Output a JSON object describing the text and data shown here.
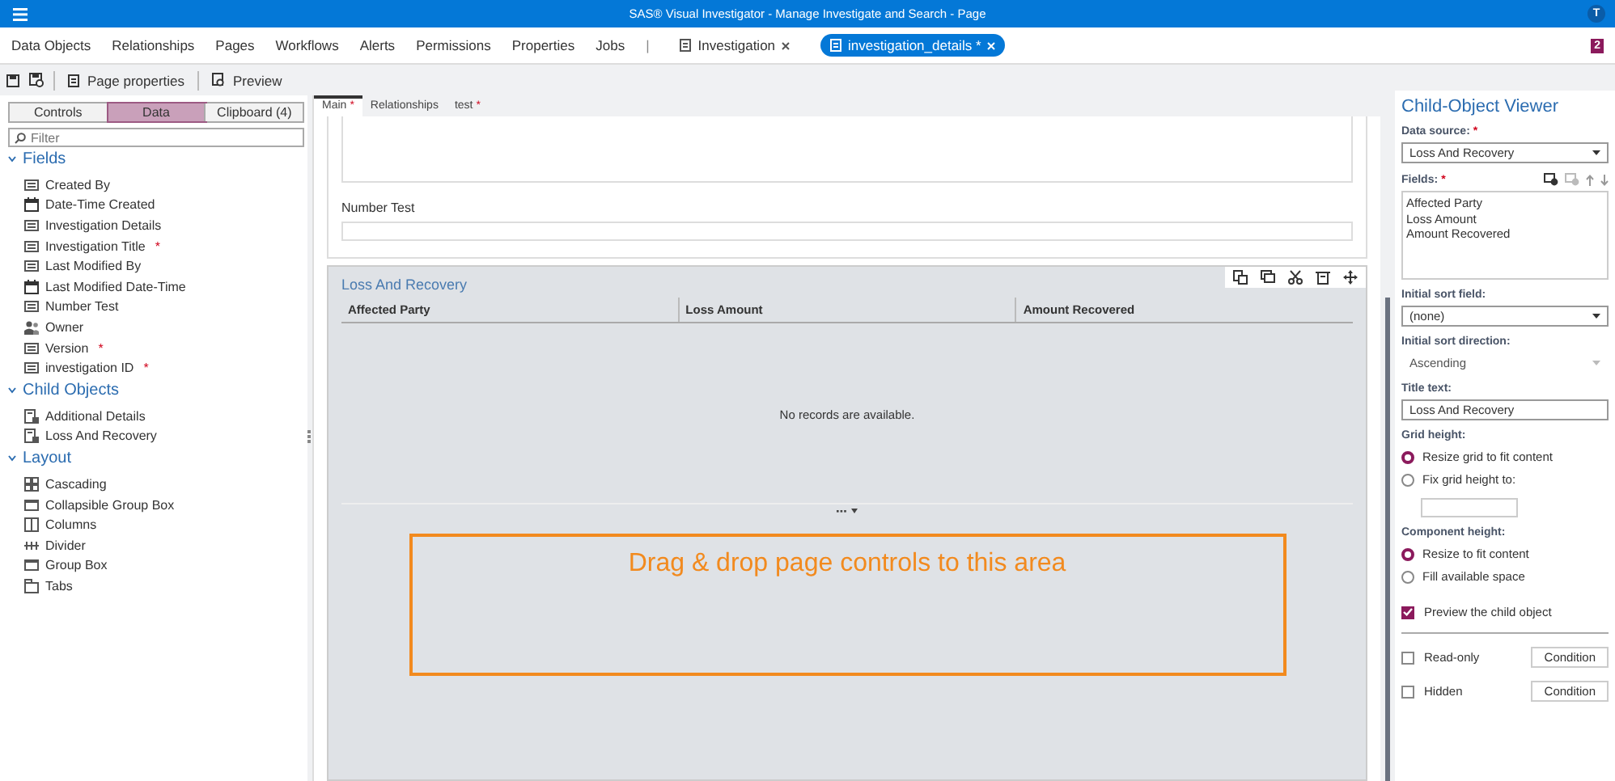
{
  "app_bar": {
    "title": "SAS® Visual Investigator - Manage Investigate and Search - Page",
    "avatar": "T"
  },
  "nav": {
    "items": [
      "Data Objects",
      "Relationships",
      "Pages",
      "Workflows",
      "Alerts",
      "Permissions",
      "Properties",
      "Jobs"
    ],
    "separator": "|",
    "open_tabs": [
      {
        "label": "Investigation",
        "selected": false
      },
      {
        "label": "investigation_details *",
        "selected": true
      }
    ],
    "badge": "2"
  },
  "toolbar": {
    "buttons": [
      "Page properties",
      "Preview"
    ]
  },
  "left_panel": {
    "tabs": [
      {
        "label": "Controls",
        "selected": false
      },
      {
        "label": "Data",
        "selected": true
      },
      {
        "label": "Clipboard (4)",
        "selected": false
      }
    ],
    "filter": {
      "placeholder": "Filter"
    },
    "sections": [
      {
        "title": "Fields",
        "expanded": true,
        "items": [
          {
            "label": "Created By",
            "kind": "text"
          },
          {
            "label": "Date-Time Created",
            "kind": "date"
          },
          {
            "label": "Investigation Details",
            "kind": "text"
          },
          {
            "label": "Investigation Title",
            "kind": "text",
            "marker": "*"
          },
          {
            "label": "Last Modified By",
            "kind": "text"
          },
          {
            "label": "Last Modified Date-Time",
            "kind": "date"
          },
          {
            "label": "Number Test",
            "kind": "text"
          },
          {
            "label": "Owner",
            "kind": "user"
          },
          {
            "label": "Version",
            "kind": "text",
            "marker": "*"
          },
          {
            "label": "investigation ID",
            "kind": "text",
            "marker": "*"
          }
        ]
      },
      {
        "title": "Child Objects",
        "expanded": true,
        "items": [
          {
            "label": "Additional Details",
            "kind": "child"
          },
          {
            "label": "Loss And Recovery",
            "kind": "child"
          }
        ]
      },
      {
        "title": "Layout",
        "expanded": true,
        "items": [
          {
            "label": "Cascading",
            "kind": "cascading"
          },
          {
            "label": "Collapsible Group Box",
            "kind": "groupbox"
          },
          {
            "label": "Columns",
            "kind": "columns"
          },
          {
            "label": "Divider",
            "kind": "divider"
          },
          {
            "label": "Group Box",
            "kind": "groupbox"
          },
          {
            "label": "Tabs",
            "kind": "tabs"
          }
        ]
      }
    ]
  },
  "canvas": {
    "tabs": [
      {
        "label": "Main",
        "marker": "*",
        "selected": true
      },
      {
        "label": "Relationships",
        "selected": false
      },
      {
        "label": "test",
        "marker": "*",
        "selected": false
      }
    ],
    "number_field": {
      "label": "Number Test"
    },
    "child_grid": {
      "title": "Loss And Recovery",
      "columns": [
        "Affected Party",
        "Loss Amount",
        "Amount Recovered"
      ],
      "empty_message": "No records are available."
    },
    "drop_zone": "Drag & drop page controls to this area"
  },
  "properties": {
    "title": "Child-Object Viewer",
    "data_source": {
      "label": "Data source:",
      "marker": "*",
      "value": "Loss And Recovery"
    },
    "fields": {
      "label": "Fields:",
      "marker": "*",
      "items": [
        "Affected Party",
        "Loss Amount",
        "Amount Recovered"
      ]
    },
    "sort_field": {
      "label": "Initial sort field:",
      "value": "(none)"
    },
    "sort_direction": {
      "label": "Initial sort direction:",
      "value": "Ascending",
      "disabled": true
    },
    "title_text": {
      "label": "Title text:",
      "value": "Loss And Recovery"
    },
    "grid_height": {
      "label": "Grid height:",
      "options": [
        {
          "label": "Resize grid to fit content",
          "selected": true
        },
        {
          "label": "Fix grid height to:",
          "selected": false
        }
      ]
    },
    "component_height": {
      "label": "Component height:",
      "options": [
        {
          "label": "Resize to fit content",
          "selected": true
        },
        {
          "label": "Fill available space",
          "selected": false
        }
      ]
    },
    "preview": {
      "label": "Preview the child object",
      "checked": true
    },
    "flags": [
      {
        "label": "Read-only",
        "checked": false,
        "button": "Condition"
      },
      {
        "label": "Hidden",
        "checked": false,
        "button": "Condition"
      }
    ]
  }
}
